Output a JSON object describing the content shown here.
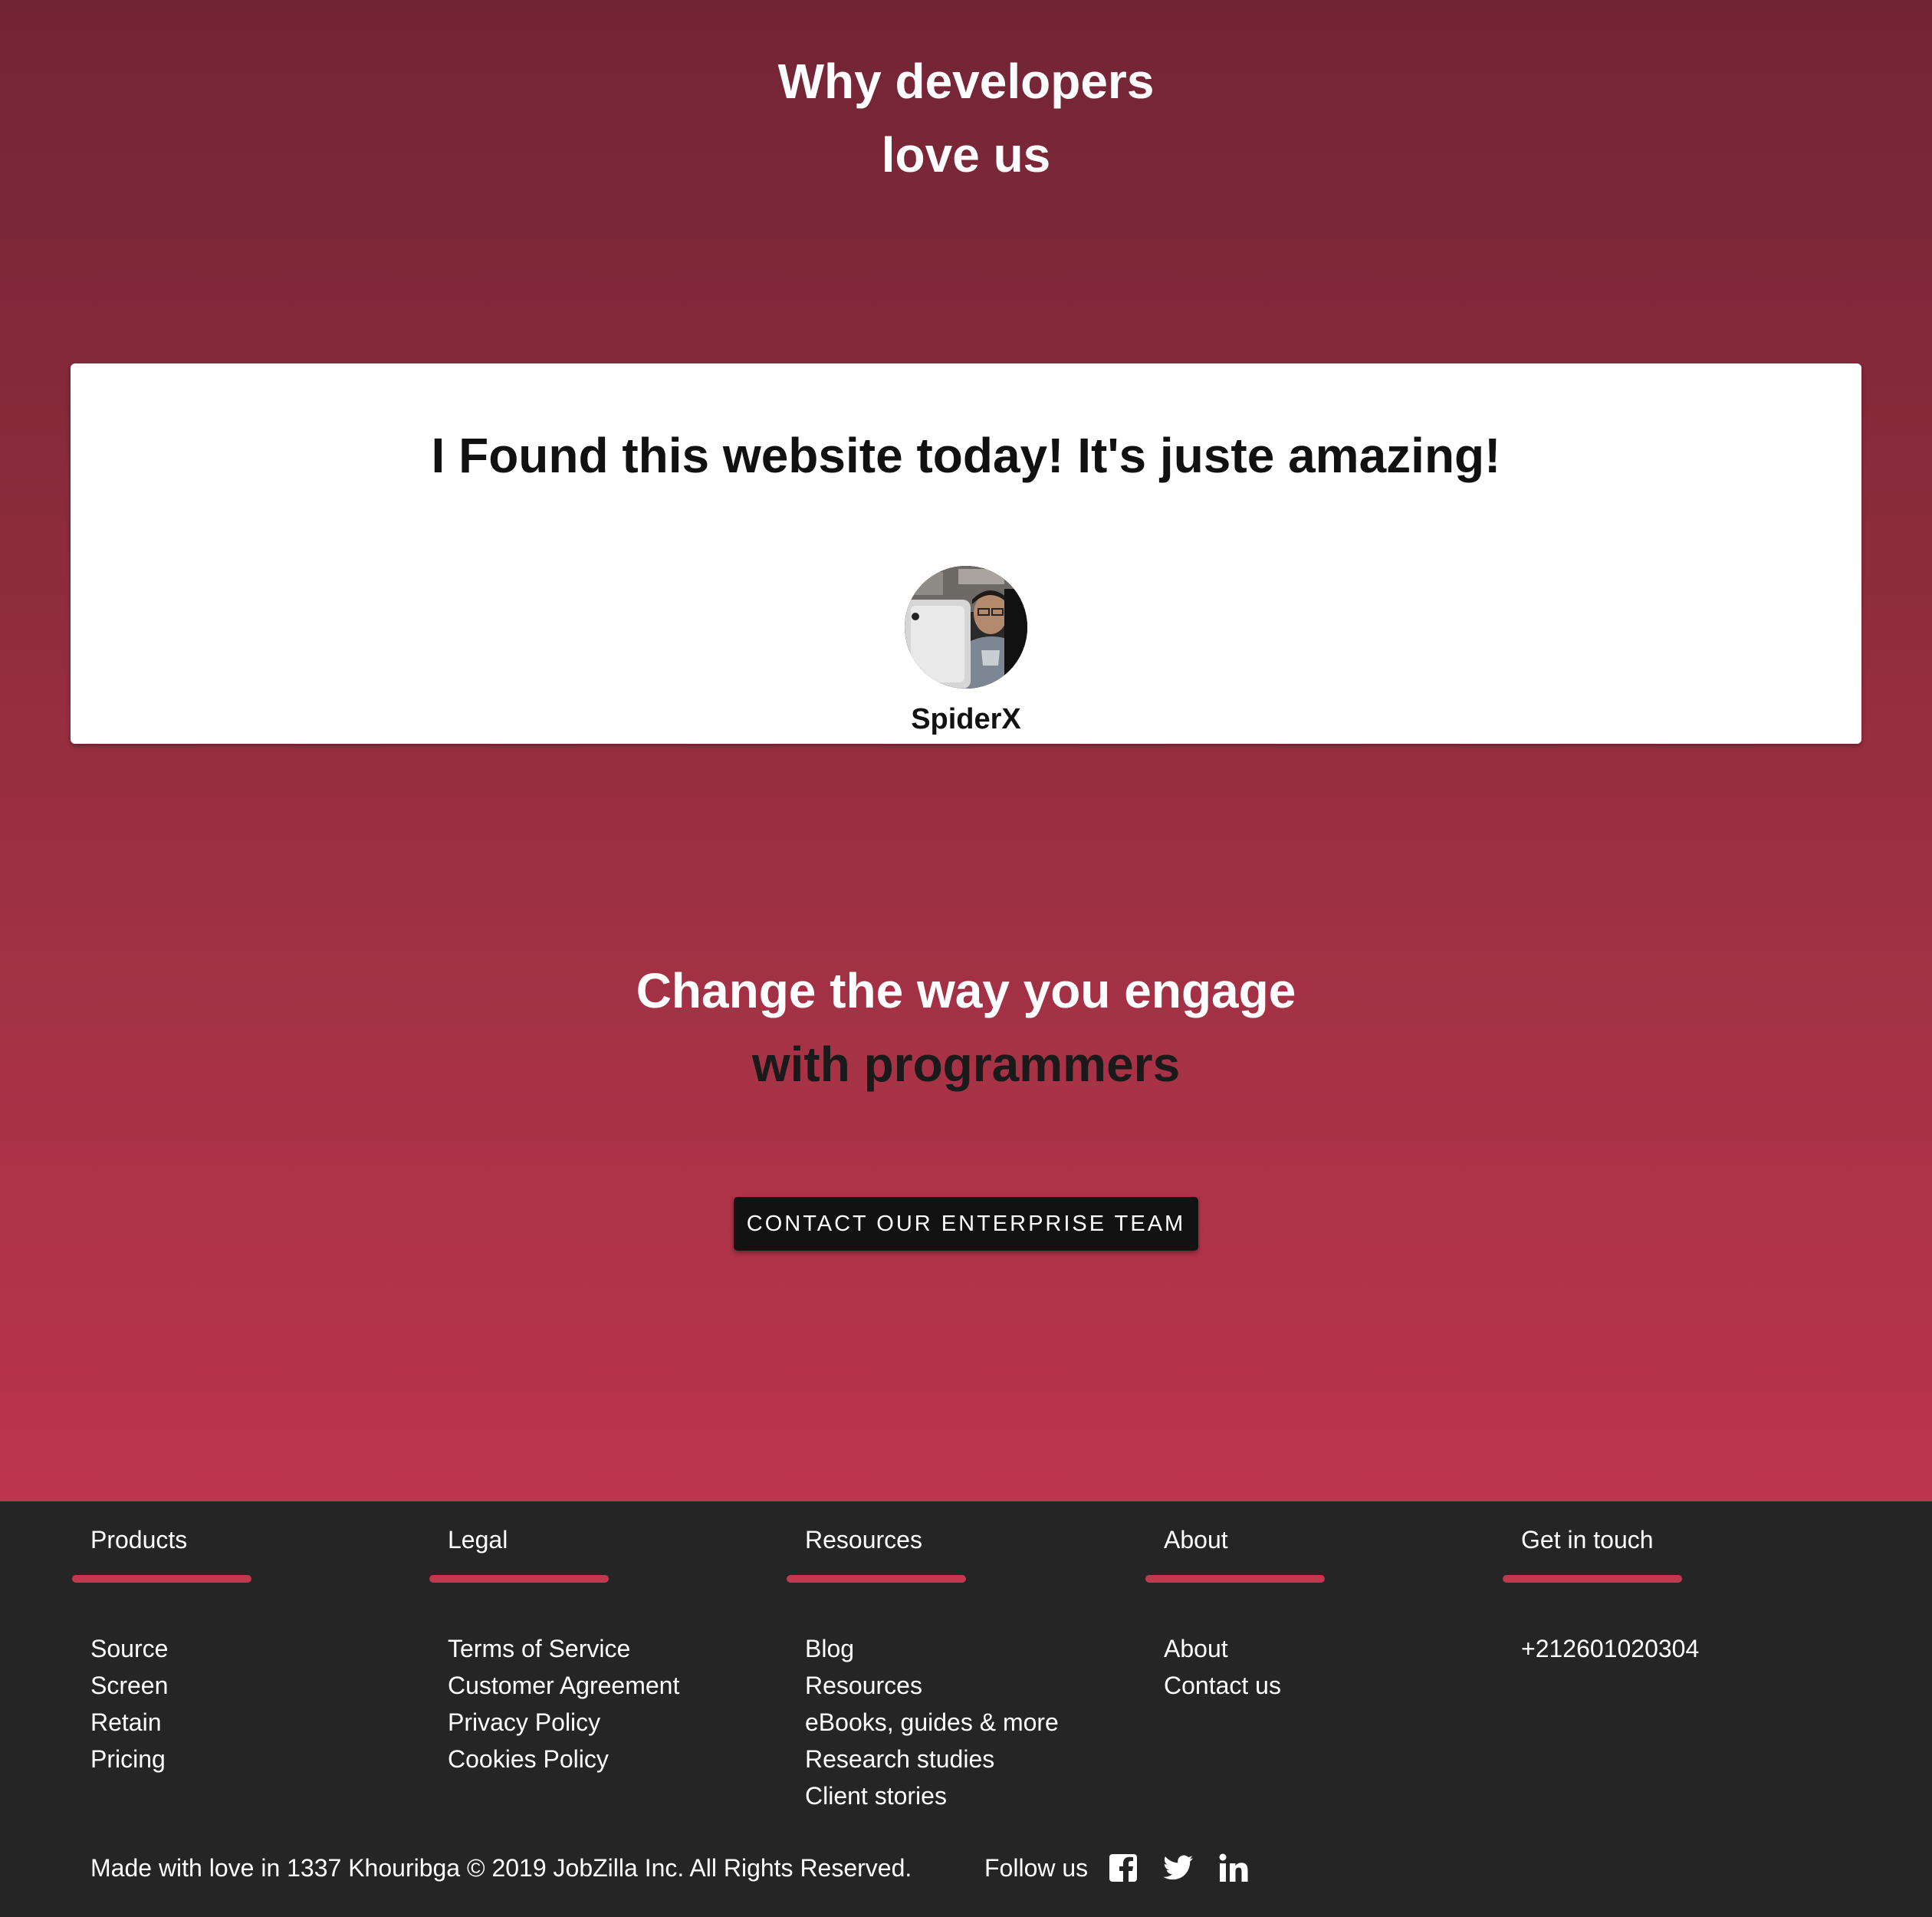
{
  "testimonials": {
    "heading_line1": "Why developers",
    "heading_line2": "love us",
    "quote": "I Found this website today! It's juste amazing!",
    "author": "SpiderX"
  },
  "cta": {
    "heading_line1": "Change the way you engage",
    "heading_line2": "with programmers",
    "button_label": "Contact our enterprise team"
  },
  "footer": {
    "columns": [
      {
        "title": "Products",
        "links": [
          "Source",
          "Screen",
          "Retain",
          "Pricing"
        ]
      },
      {
        "title": "Legal",
        "links": [
          "Terms of Service",
          "Customer Agreement",
          "Privacy Policy",
          "Cookies Policy"
        ]
      },
      {
        "title": "Resources",
        "links": [
          "Blog",
          "Resources",
          "eBooks, guides & more",
          "Research studies",
          "Client stories"
        ]
      },
      {
        "title": "About",
        "links": [
          "About",
          "Contact us"
        ]
      },
      {
        "title": "Get in touch",
        "links": [
          "+212601020304"
        ]
      }
    ],
    "copyright": "Made with love in 1337 Khouribga © 2019 JobZilla Inc. All Rights Reserved.",
    "follow_label": "Follow us",
    "social_icons": [
      "facebook-icon",
      "twitter-icon",
      "linkedin-icon"
    ]
  },
  "colors": {
    "gradient_top": "#722535",
    "gradient_bottom": "#bc344d",
    "accent": "#c0394f",
    "footer_bg": "#252525",
    "button_bg": "#121212"
  }
}
